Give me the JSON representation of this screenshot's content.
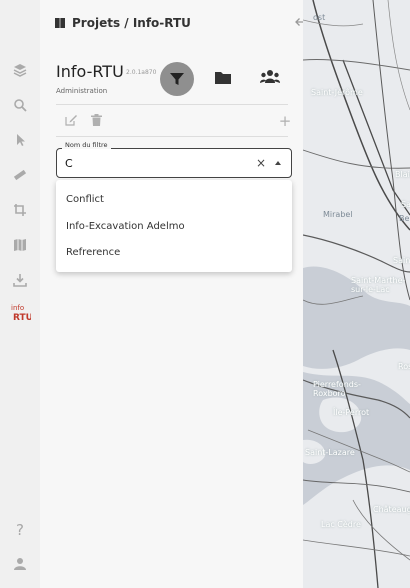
{
  "header": {
    "title": "Projets / Info-RTU"
  },
  "app": {
    "name": "Info-RTU",
    "version": "2.0.1a870",
    "subtitle": "Administration"
  },
  "filter_field": {
    "legend": "Nom du filtre",
    "value": "C",
    "clear_glyph": "×"
  },
  "dropdown": {
    "options": [
      "Conflict",
      "Info-Excavation Adelmo",
      "Refrerence"
    ]
  },
  "tools": {
    "add_glyph": "+"
  },
  "rail": {
    "brand_logo_text": "info RTU",
    "help_glyph": "?"
  },
  "map": {
    "labels": [
      "ost",
      "Saint-Jérôme",
      "Mirabel",
      "Blainv",
      "Sain",
      "Be",
      "Sain",
      "Saint-Marthe-sur-le-Lac",
      "Rose",
      "Pierrefonds-Roxboro",
      "Saint-Lazare",
      "Châteauguay",
      "Lac Cèdre",
      "Île-Perrot"
    ]
  },
  "colors": {
    "accent_brand": "#c0392b",
    "filter_button": "#8f8f8f",
    "water": "#c9ced6",
    "land": "#e9ebee",
    "roads": "#4a4a4a"
  },
  "icons": {
    "rail": [
      "layers-icon",
      "search-icon",
      "pointer-icon",
      "ruler-icon",
      "crop-icon",
      "map-icon",
      "download-icon",
      "info-rtu-logo",
      "help-icon",
      "user-icon"
    ],
    "header": "book-icon",
    "toolbar": [
      "filter-icon",
      "folder-icon",
      "people-icon"
    ],
    "tools": [
      "edit-icon",
      "trash-icon",
      "plus-icon"
    ],
    "panel": "arrow-left-icon"
  }
}
